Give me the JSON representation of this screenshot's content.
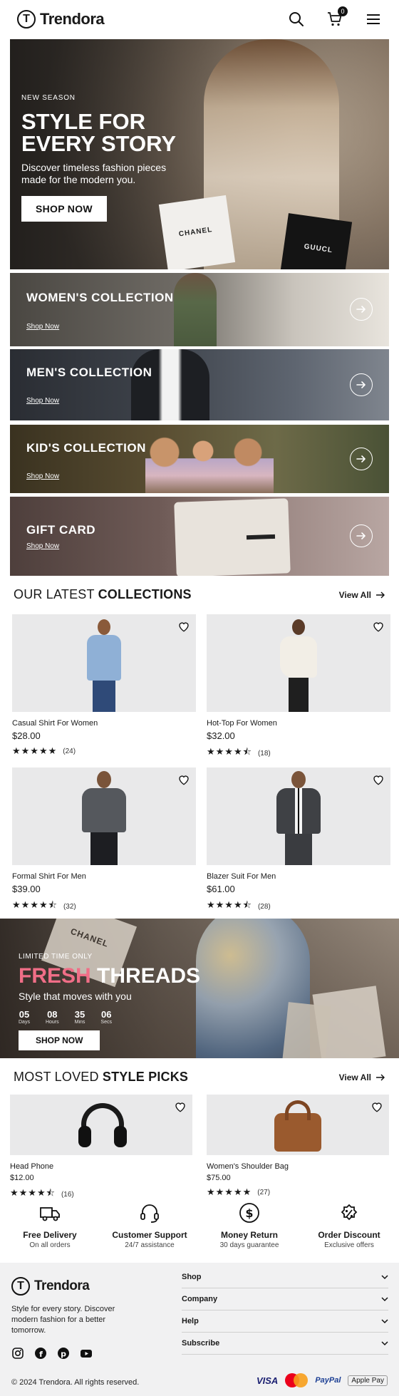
{
  "brand": {
    "name": "Trendora",
    "mark": "T"
  },
  "header": {
    "cart_count": "0"
  },
  "hero": {
    "eyebrow": "NEW SEASON",
    "title": "STYLE FOR EVERY STORY",
    "subtitle": "Discover timeless fashion pieces made for the modern you.",
    "button": "SHOP NOW",
    "bag_labels": [
      "CHANEL",
      "GUUCL"
    ]
  },
  "collections": [
    {
      "title": "WOMEN'S COLLECTION",
      "link": "Shop Now"
    },
    {
      "title": "MEN'S COLLECTION",
      "link": "Shop Now"
    },
    {
      "title": "KID'S COLLECTION",
      "link": "Shop Now"
    },
    {
      "title": "GIFT CARD",
      "link": "Shop Now"
    }
  ],
  "latest": {
    "title_light": "OUR LATEST ",
    "title_bold": "COLLECTIONS",
    "view_all": "View All",
    "products": [
      {
        "name": "Casual Shirt For Women",
        "price": "$28.00",
        "rating": 5,
        "reviews": "(24)"
      },
      {
        "name": "Hot-Top For Women",
        "price": "$32.00",
        "rating": 4.5,
        "reviews": "(18)"
      },
      {
        "name": "Formal Shirt For Men",
        "price": "$39.00",
        "rating": 4.5,
        "reviews": "(32)"
      },
      {
        "name": "Blazer Suit For Men",
        "price": "$61.00",
        "rating": 4.5,
        "reviews": "(28)"
      }
    ]
  },
  "promo": {
    "eyebrow": "LIMITED TIME ONLY",
    "title_accent": "FRESH",
    "title_rest": " THREADS",
    "subtitle": "Style that moves with you",
    "countdown": [
      {
        "value": "05",
        "label": "Days"
      },
      {
        "value": "08",
        "label": "Hours"
      },
      {
        "value": "35",
        "label": "Mins"
      },
      {
        "value": "06",
        "label": "Secs"
      }
    ],
    "button": "SHOP NOW",
    "bag_label": "CHANEL"
  },
  "loved": {
    "title_light": "MOST LOVED ",
    "title_bold": "STYLE PICKS",
    "view_all": "View All",
    "products": [
      {
        "name": "Head Phone",
        "price": "$12.00",
        "rating": 4.5,
        "reviews": "(16)"
      },
      {
        "name": "Women's Shoulder Bag",
        "price": "$75.00",
        "rating": 5,
        "reviews": "(27)"
      }
    ]
  },
  "features": [
    {
      "icon": "truck-icon",
      "title": "Free Delivery",
      "sub": "On all orders"
    },
    {
      "icon": "headset-icon",
      "title": "Customer Support",
      "sub": "24/7 assistance"
    },
    {
      "icon": "dollar-icon",
      "title": "Money Return",
      "sub": "30 days guarantee"
    },
    {
      "icon": "discount-icon",
      "title": "Order Discount",
      "sub": "Exclusive offers"
    }
  ],
  "footer": {
    "tagline": "Style for every story. Discover modern fashion for a better tomorrow.",
    "sections": [
      "Shop",
      "Company",
      "Help",
      "Subscribe"
    ],
    "copyright": "© 2024 Trendora. All rights reserved.",
    "payments": [
      "VISA",
      "Mastercard",
      "PayPal",
      "Apple Pay"
    ]
  }
}
